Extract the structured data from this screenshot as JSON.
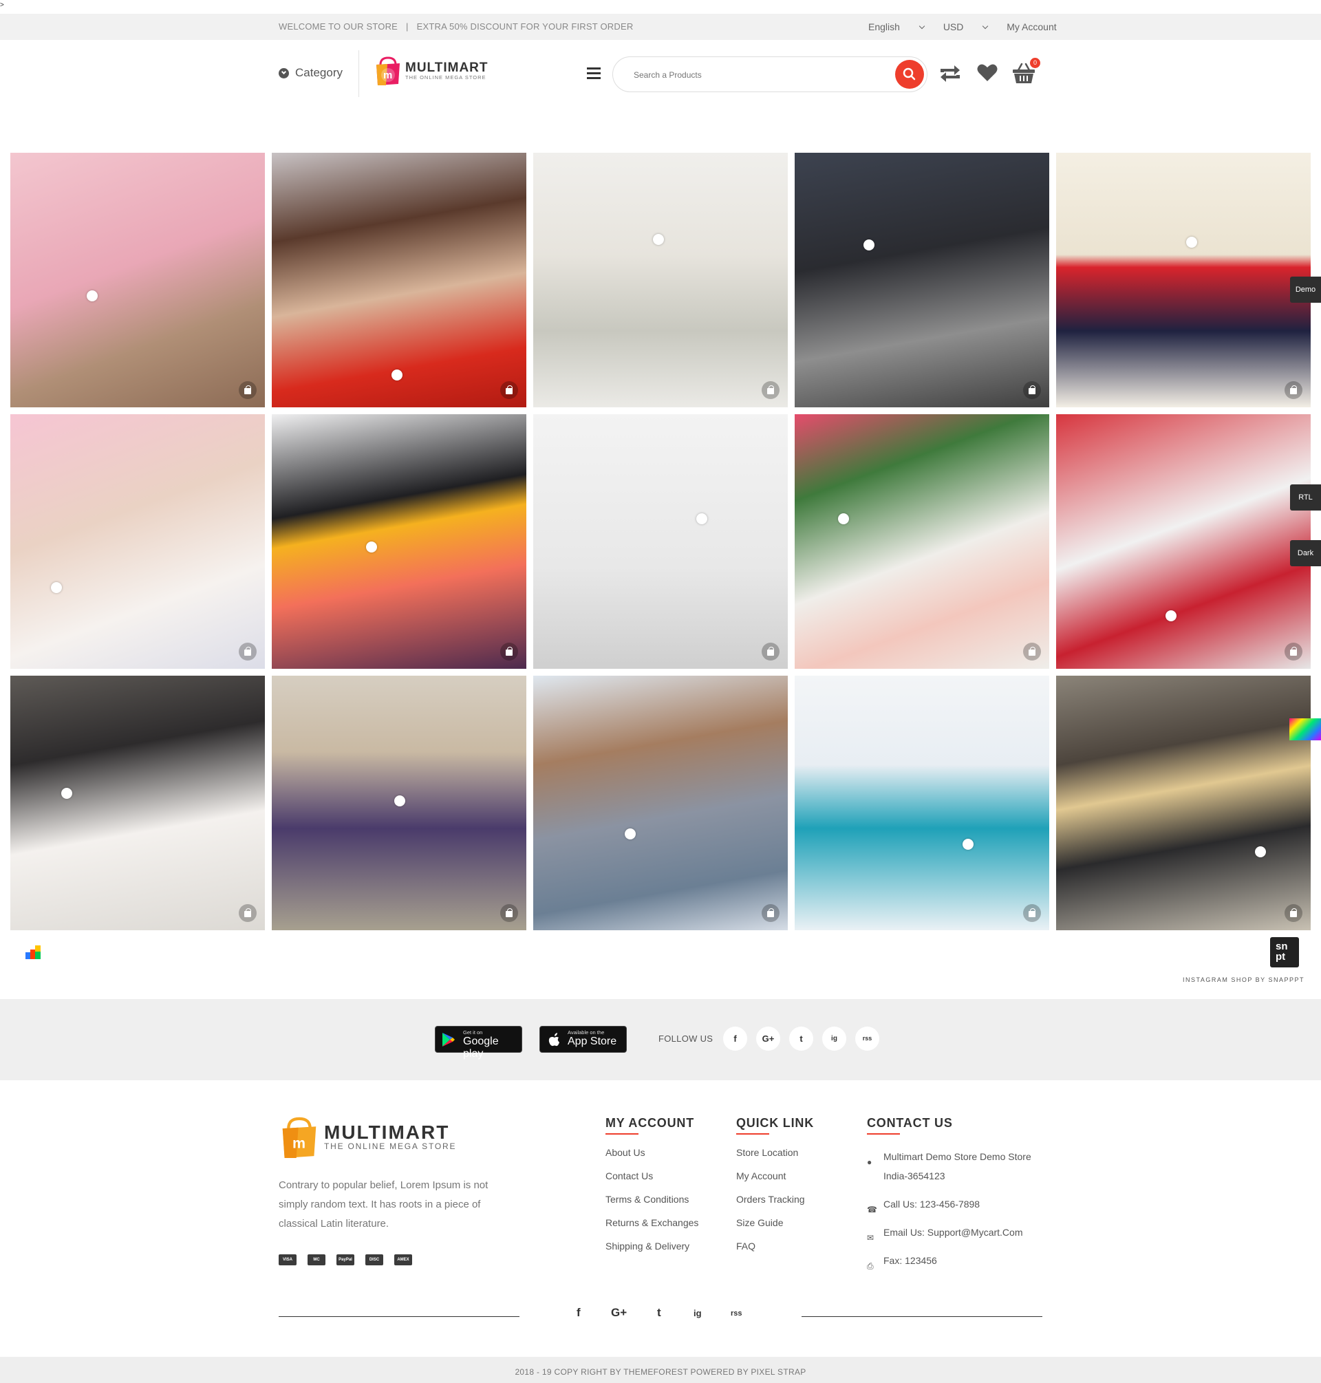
{
  "page_marker": ">",
  "topbar": {
    "welcome": "WELCOME TO OUR STORE",
    "separator": "|",
    "promo": "EXTRA 50% DISCOUNT FOR YOUR FIRST ORDER",
    "language": "English",
    "currency": "USD",
    "account": "My Account"
  },
  "header": {
    "category_label": "Category",
    "logo_word": "MULTIMART",
    "logo_tagline": "THE ONLINE MEGA STORE",
    "search_placeholder": "Search a Products",
    "cart_count": "0",
    "icons": [
      "menu-icon",
      "search-icon",
      "compare-icon",
      "heart-icon",
      "cart-icon"
    ]
  },
  "instagram": {
    "tiles": [
      {
        "tile_label": "",
        "bg": "linear-gradient(160deg,#f3c6cf 0%,#e9a7b6 45%,#b08f76 70%,#8c6b55 100%)",
        "dot": [
          30,
          54
        ]
      },
      {
        "tile_label": "",
        "bg": "linear-gradient(170deg,#c8c2c4 0%,#5a3a2c 30%,#d9b59a 55%,#d82a1d 80%,#b11b12 100%)",
        "dot": [
          47,
          85
        ]
      },
      {
        "tile_label": "",
        "bg": "linear-gradient(180deg,#f0efec 0%,#e7e4dd 40%,#c8c8bf 70%,#ebeae6 100%)",
        "dot": [
          47,
          32
        ]
      },
      {
        "tile_label": "",
        "bg": "linear-gradient(170deg,#3d4350 0%,#2a2b30 40%,#8e8e8e 70%,#3f3f3f 100%)",
        "dot": [
          27,
          34
        ]
      },
      {
        "tile_label": "",
        "bg": "linear-gradient(180deg,#f4efe3 0%,#ebe3d1 40%,#d9242c 45%,#1f2240 70%,#f3eee5 100%)",
        "dot": [
          51,
          33
        ]
      },
      {
        "tile_label": "",
        "bg": "linear-gradient(160deg,#f6c5d3 0%,#ead2c4 40%,#f6f2ef 70%,#dcdde8 100%)",
        "dot": [
          16,
          66
        ]
      },
      {
        "tile_label": "",
        "bg": "linear-gradient(170deg,#efeff0 0%,#1f1f22 35%,#f5b11f 45%,#f3705a 65%,#4c2a4e 100%)",
        "dot": [
          37,
          50
        ]
      },
      {
        "tile_label": "",
        "bg": "linear-gradient(180deg,#f3f3f3 0%,#e8e8e8 60%,#cfcfcf 100%)",
        "dot": [
          64,
          39
        ]
      },
      {
        "tile_label": "",
        "bg": "linear-gradient(160deg,#e64c6c 0%,#3f7a3c 25%,#f0eeea 55%,#f3c7bd 75%,#efeeea 100%)",
        "dot": [
          17,
          39
        ]
      },
      {
        "tile_label": "",
        "bg": "linear-gradient(160deg,#d7363f 0%,#f1f1f1 45%,#c82130 70%,#e6e6e6 100%)",
        "dot": [
          43,
          77
        ]
      },
      {
        "tile_label": "",
        "bg": "linear-gradient(170deg,#5e5a56 0%,#2d2b2c 30%,#f4f1ee 60%,#dcd9d4 100%)",
        "dot": [
          20,
          44
        ]
      },
      {
        "tile_label": "",
        "bg": "linear-gradient(180deg,#d6cec1 0%,#c9b9a3 30%,#4a3b6b 60%,#a7a08f 100%)",
        "dot": [
          48,
          47
        ]
      },
      {
        "tile_label": "",
        "bg": "linear-gradient(170deg,#dfe7ef 0%,#a57d60 30%,#8b93a2 55%,#6b7f94 80%,#d6dde6 100%)",
        "dot": [
          36,
          60
        ]
      },
      {
        "tile_label": "",
        "bg": "linear-gradient(180deg,#f3f5f7 0%,#e8eef3 35%,#1fa1b8 60%,#eaf1f5 100%)",
        "dot": [
          66,
          64
        ]
      },
      {
        "tile_label": "",
        "bg": "linear-gradient(170deg,#8b8479 0%,#4c443c 30%,#e1c891 45%,#2a2a2c 65%,#c8c1b3 100%)",
        "dot": [
          78,
          67
        ]
      }
    ],
    "tab_demo": "Demo",
    "tab_rtl": "RTL",
    "tab_dark": "Dark",
    "snappt_logo_top": "sn",
    "snappt_logo_bottom": "pt",
    "snappt_caption": "INSTAGRAM SHOP BY SNAPPPT"
  },
  "app_strip": {
    "google_small": "Get it on",
    "google_big": "Google play",
    "apple_small": "Available on the",
    "apple_big": "App Store",
    "follow_label": "FOLLOW US",
    "social": [
      "f",
      "G+",
      "t",
      "ig",
      "rss"
    ]
  },
  "footer": {
    "logo_word": "MULTIMART",
    "logo_tagline": "THE ONLINE MEGA STORE",
    "about": "Contrary to popular belief, Lorem Ipsum is not simply random text. It has roots in a piece of classical Latin literature.",
    "payments": [
      "VISA",
      "MC",
      "PayPal",
      "DISC",
      "AMEX"
    ],
    "my_account": {
      "title": "MY ACCOUNT",
      "links": [
        "About Us",
        "Contact Us",
        "Terms & Conditions",
        "Returns & Exchanges",
        "Shipping & Delivery"
      ]
    },
    "quick_link": {
      "title": "QUICK LINK",
      "links": [
        "Store Location",
        "My Account",
        "Orders Tracking",
        "Size Guide",
        "FAQ"
      ]
    },
    "contact": {
      "title": "CONTACT US",
      "address_line1": "Multimart Demo Store Demo Store",
      "address_line2": "India-3654123",
      "phone": "Call Us: 123-456-7898",
      "email": "Email Us: Support@Mycart.Com",
      "fax": "Fax: 123456"
    },
    "bottom_social": [
      "f",
      "G+",
      "t",
      "ig",
      "rss"
    ],
    "copyright": "2018 - 19 COPY RIGHT BY THEMEFOREST POWERED BY PIXEL STRAP"
  },
  "colors": {
    "accent": "#ee3e2c",
    "logo_orange": "#f5a623",
    "logo_pink": "#e91e63"
  }
}
